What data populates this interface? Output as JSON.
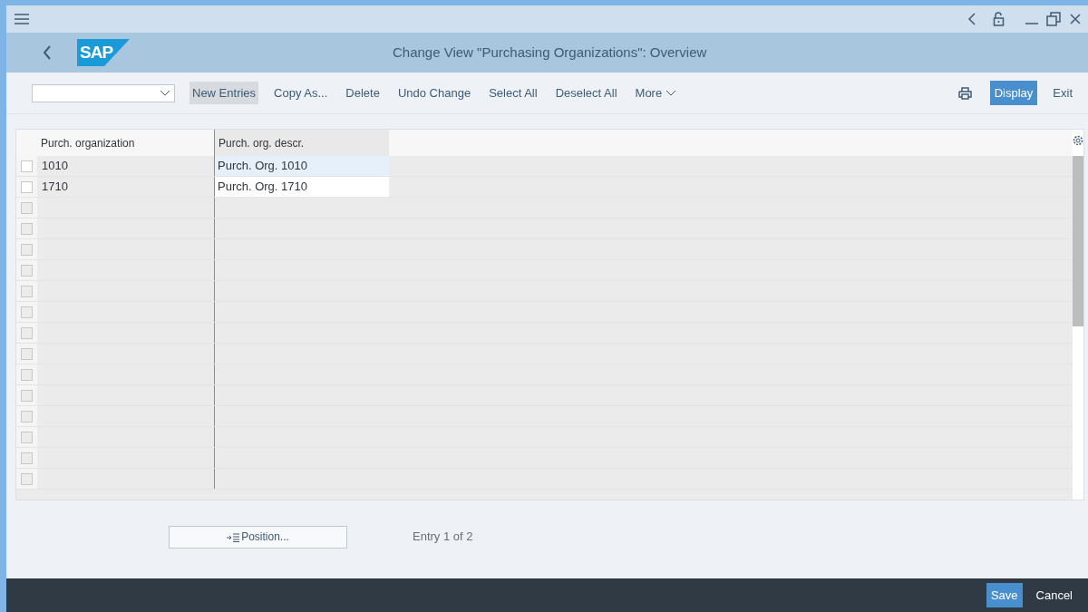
{
  "window": {
    "title": "Change View \"Purchasing Organizations\": Overview",
    "logo": "SAP"
  },
  "toolbar": {
    "buttons": [
      {
        "label": "New Entries",
        "kind": "plain",
        "hovered": true
      },
      {
        "label": "Copy As...",
        "kind": "plain",
        "hovered": false
      },
      {
        "label": "Delete",
        "kind": "plain",
        "hovered": false
      },
      {
        "label": "Undo Change",
        "kind": "plain",
        "hovered": false
      },
      {
        "label": "Select All",
        "kind": "plain",
        "hovered": false
      },
      {
        "label": "Deselect All",
        "kind": "plain",
        "hovered": false
      },
      {
        "label": "More",
        "kind": "menu",
        "hovered": false
      }
    ],
    "right_buttons": [
      {
        "label": "Display",
        "kind": "emphasized"
      },
      {
        "label": "Exit",
        "kind": "plain"
      }
    ]
  },
  "table": {
    "columns": [
      "Purch. organization",
      "Purch. org. descr."
    ],
    "rows": [
      {
        "kind": "entry",
        "checked": false,
        "selected": true,
        "cells": [
          "1010",
          "Purch. Org. 1010"
        ]
      },
      {
        "kind": "entry",
        "checked": false,
        "selected": false,
        "cells": [
          "1710",
          "Purch. Org. 1710"
        ]
      },
      {
        "kind": "blank",
        "checked": false
      },
      {
        "kind": "blank",
        "checked": false
      },
      {
        "kind": "blank",
        "checked": false
      },
      {
        "kind": "blank",
        "checked": false
      },
      {
        "kind": "blank",
        "checked": false
      },
      {
        "kind": "blank",
        "checked": false
      },
      {
        "kind": "blank",
        "checked": false
      },
      {
        "kind": "blank",
        "checked": false
      },
      {
        "kind": "blank",
        "checked": false
      },
      {
        "kind": "blank",
        "checked": false
      },
      {
        "kind": "blank",
        "checked": false
      },
      {
        "kind": "blank",
        "checked": false
      },
      {
        "kind": "blank",
        "checked": false
      },
      {
        "kind": "blank",
        "checked": false
      }
    ]
  },
  "position_button": {
    "label": "Position..."
  },
  "entry_info": "Entry 1 of 2",
  "footer": {
    "buttons": [
      {
        "label": "Save",
        "kind": "emphasized"
      },
      {
        "label": "Cancel",
        "kind": "plain"
      }
    ]
  }
}
